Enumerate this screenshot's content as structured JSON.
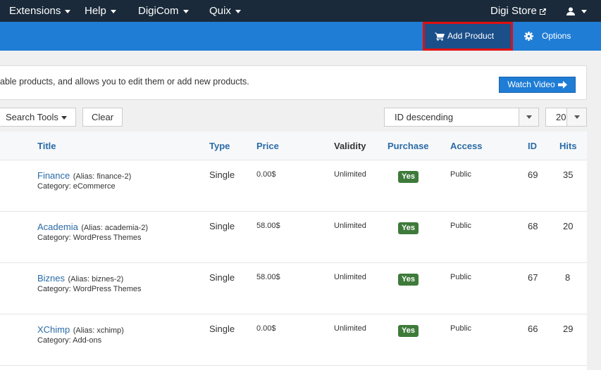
{
  "topnav": {
    "items": [
      {
        "label": "Extensions"
      },
      {
        "label": "Help"
      },
      {
        "label": "DigiCom"
      },
      {
        "label": "Quix"
      }
    ],
    "store_label": "Digi Store"
  },
  "toolbar": {
    "add_product_label": "Add Product",
    "options_label": "Options"
  },
  "info": {
    "text": "able products, and allows you to edit them or add new products.",
    "video_label": "Watch Video"
  },
  "filters": {
    "search_tools_label": "Search Tools",
    "clear_label": "Clear",
    "ordering_value": "ID descending",
    "limit_value": "20"
  },
  "table": {
    "headers": {
      "title": "Title",
      "type": "Type",
      "price": "Price",
      "validity": "Validity",
      "purchase": "Purchase",
      "access": "Access",
      "id": "ID",
      "hits": "Hits"
    },
    "rows": [
      {
        "title": "Finance",
        "alias": "(Alias: finance-2)",
        "category": "Category: eCommerce",
        "type": "Single",
        "price": "0.00$",
        "validity": "Unlimited",
        "purchase": "Yes",
        "access": "Public",
        "id": "69",
        "hits": "35"
      },
      {
        "title": "Academia",
        "alias": "(Alias: academia-2)",
        "category": "Category: WordPress Themes",
        "type": "Single",
        "price": "58.00$",
        "validity": "Unlimited",
        "purchase": "Yes",
        "access": "Public",
        "id": "68",
        "hits": "20"
      },
      {
        "title": "Biznes",
        "alias": "(Alias: biznes-2)",
        "category": "Category: WordPress Themes",
        "type": "Single",
        "price": "58.00$",
        "validity": "Unlimited",
        "purchase": "Yes",
        "access": "Public",
        "id": "67",
        "hits": "8"
      },
      {
        "title": "XChimp",
        "alias": "(Alias: xchimp)",
        "category": "Category: Add-ons",
        "type": "Single",
        "price": "0.00$",
        "validity": "Unlimited",
        "purchase": "Yes",
        "access": "Public",
        "id": "66",
        "hits": "29"
      }
    ]
  },
  "colors": {
    "topnav_bg": "#1a2a3a",
    "toolbar_bg": "#1f7dd6",
    "add_button_bg": "#1b4f8a",
    "highlight_border": "#e01010",
    "link": "#2a6ba6",
    "badge_bg": "#3e7a3a"
  }
}
